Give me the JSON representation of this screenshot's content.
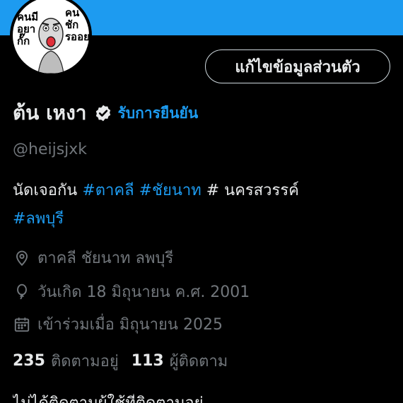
{
  "colors": {
    "banner": "#1d9bf0",
    "accent": "#1d9bf0",
    "text_primary": "#e7e9ea",
    "text_secondary": "#71767b",
    "background": "#000000"
  },
  "avatar": {
    "lines_left": [
      "คนมี",
      "อยา",
      "กั๊ก"
    ],
    "lines_right": [
      "คน",
      "ชัก",
      "รออย"
    ]
  },
  "profile": {
    "edit_button_label": "แก้ไขข้อมูลส่วนตัว",
    "display_name": "ต้น เหงา",
    "verify_label": "รับการยืนยัน",
    "handle": "@heijsjxk"
  },
  "bio": {
    "text_prefix": "นัดเจอกัน ",
    "tags": [
      "#ตาคลี",
      "#ชัยนาท",
      "#ลพบุรี"
    ],
    "plain_hash": "# นครสวรรค์"
  },
  "meta": {
    "location": "ตาคลี ชัยนาท ลพบุรี",
    "birthday": "วันเกิด 18 มิถุนายน ค.ศ. 2001",
    "joined": "เข้าร่วมเมื่อ มิถุนายน 2025"
  },
  "stats": {
    "following_count": "235",
    "following_label": "ติดตามอยู่",
    "followers_count": "113",
    "followers_label": "ผู้ติดตาม"
  },
  "cutoff_text": "ไม่ได้ติดตามผู้ใช้ที่ติดตามอยู่"
}
